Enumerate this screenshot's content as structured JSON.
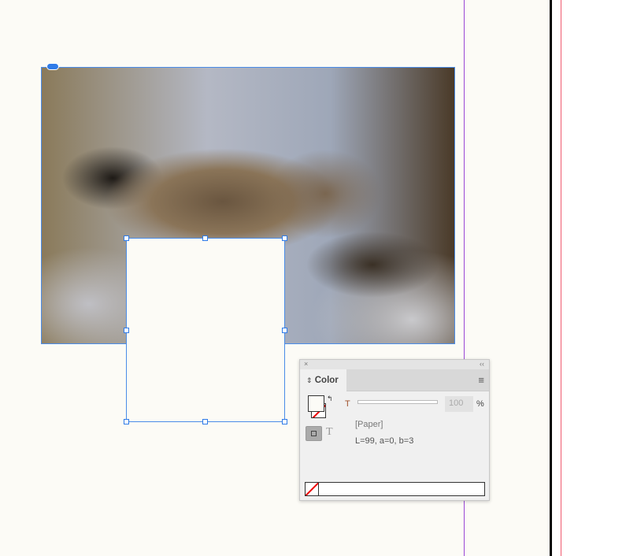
{
  "color_panel": {
    "close": "×",
    "collapse": "‹‹",
    "tab_arrow": "⇕",
    "tab_label": "Color",
    "menu": "≡",
    "tint_label": "T",
    "tint_value": "100",
    "tint_unit": "%",
    "swatch_name": "[Paper]",
    "swatch_value": "L=99, a=0, b=3",
    "text_toggle": "T",
    "fill_color": "#fcfbf6"
  }
}
